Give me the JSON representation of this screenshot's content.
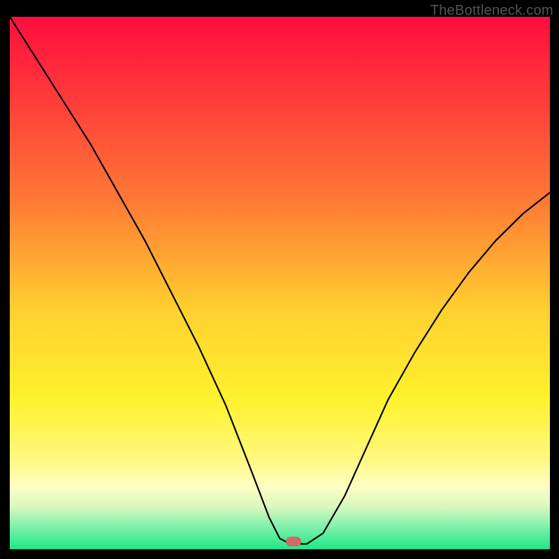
{
  "watermark": "TheBottleneck.com",
  "marker": {
    "color": "#cf6a69",
    "x_pct": 52.5,
    "y_pct": 98.5
  },
  "chart_data": {
    "type": "line",
    "title": "",
    "xlabel": "",
    "ylabel": "",
    "xlim": [
      0,
      100
    ],
    "ylim": [
      0,
      100
    ],
    "background_gradient": {
      "stops": [
        {
          "offset": 0.0,
          "color": "#ff0d3e"
        },
        {
          "offset": 0.15,
          "color": "#ff3a3a"
        },
        {
          "offset": 0.35,
          "color": "#ff7b35"
        },
        {
          "offset": 0.55,
          "color": "#ffd02f"
        },
        {
          "offset": 0.72,
          "color": "#fff22e"
        },
        {
          "offset": 0.83,
          "color": "#fff87e"
        },
        {
          "offset": 0.88,
          "color": "#fffec2"
        },
        {
          "offset": 0.92,
          "color": "#d8f8bf"
        },
        {
          "offset": 0.96,
          "color": "#7af0a9"
        },
        {
          "offset": 1.0,
          "color": "#1ee887"
        }
      ]
    },
    "series": [
      {
        "name": "bottleneck-curve",
        "color": "#000000",
        "stroke_width": 2.2,
        "x": [
          0,
          5,
          10,
          15,
          20,
          25,
          30,
          35,
          40,
          45,
          48,
          50,
          52,
          55,
          58,
          62,
          66,
          70,
          75,
          80,
          85,
          90,
          95,
          100
        ],
        "y": [
          100,
          92,
          84,
          76,
          67,
          58,
          48,
          38,
          27,
          14,
          6,
          2,
          1,
          1,
          3,
          10,
          19,
          28,
          37,
          45,
          52,
          58,
          63,
          67
        ]
      }
    ]
  }
}
